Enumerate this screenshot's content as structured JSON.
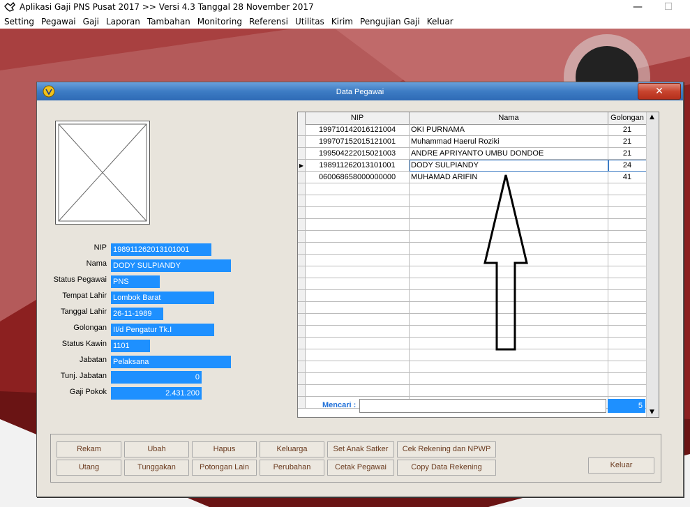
{
  "app": {
    "title": "Aplikasi Gaji PNS Pusat 2017 >> Versi 4.3 Tanggal 28 November 2017",
    "minimize": "—",
    "maximize": "☐"
  },
  "menu": [
    "Setting",
    "Pegawai",
    "Gaji",
    "Laporan",
    "Tambahan",
    "Monitoring",
    "Referensi",
    "Utilitas",
    "Kirim",
    "Pengujian Gaji",
    "Keluar"
  ],
  "dialog": {
    "title": "Data Pegawai",
    "close": "✕"
  },
  "fields": [
    {
      "label": "NIP",
      "value": "198911262013101001"
    },
    {
      "label": "Nama",
      "value": "DODY SULPIANDY"
    },
    {
      "label": "Status Pegawai",
      "value": "PNS"
    },
    {
      "label": "Tempat Lahir",
      "value": "Lombok Barat"
    },
    {
      "label": "Tanggal Lahir",
      "value": "26-11-1989"
    },
    {
      "label": "Golongan",
      "value": "II/d  Pengatur Tk.I"
    },
    {
      "label": "Status Kawin",
      "value": "1101"
    },
    {
      "label": "Jabatan",
      "value": "Pelaksana"
    },
    {
      "label": "Tunj. Jabatan",
      "value": "0"
    },
    {
      "label": "Gaji Pokok",
      "value": "2.431.200"
    }
  ],
  "grid": {
    "headers": [
      "NIP",
      "Nama",
      "Golongan"
    ],
    "rows": [
      {
        "nip": "199710142016121004",
        "nama": "OKI PURNAMA",
        "gol": "21"
      },
      {
        "nip": "199707152015121001",
        "nama": "Muhammad Haerul Roziki",
        "gol": "21"
      },
      {
        "nip": "199504222015021003",
        "nama": "ANDRE APRIYANTO UMBU DONDOE",
        "gol": "21"
      },
      {
        "nip": "198911262013101001",
        "nama": "DODY SULPIANDY",
        "gol": "24"
      },
      {
        "nip": "060068658000000000",
        "nama": "MUHAMAD ARIFIN",
        "gol": "41"
      }
    ],
    "selected_row": 3
  },
  "search": {
    "label": "Mencari :",
    "value": "",
    "count": "5"
  },
  "buttons": {
    "row1": [
      "Rekam",
      "Ubah",
      "Hapus",
      "Keluarga",
      "Set Anak Satker",
      "Cek Rekening  dan NPWP"
    ],
    "row2": [
      "Utang",
      "Tunggakan",
      "Potongan Lain",
      "Perubahan",
      "Cetak Pegawai",
      "Copy Data Rekening"
    ],
    "keluar": "Keluar"
  },
  "colors": {
    "field_bg": "#1e90ff",
    "search_label": "#1e6fd8",
    "button_text": "#6a3a1e"
  }
}
